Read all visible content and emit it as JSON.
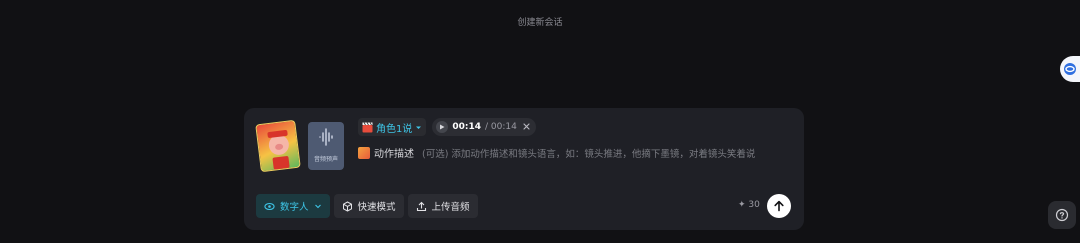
{
  "session": {
    "title": "创建新会话"
  },
  "composer": {
    "audio_thumb_label": "音频预声",
    "role": {
      "label": "角色1说"
    },
    "audio": {
      "current": "00:14",
      "total": "/ 00:14"
    },
    "action": {
      "label": "动作描述",
      "placeholder": "(可选) 添加动作描述和镜头语言，如：镜头推进，他摘下墨镜，对着镜头笑着说"
    },
    "toolbar": {
      "digital_human": "数字人",
      "fast_mode": "快速模式",
      "upload_audio": "上传音频"
    },
    "credits": "30"
  },
  "icons": [
    "help-icon",
    "ring-logo-icon",
    "play-icon",
    "close-icon",
    "eye-icon",
    "chevron-down-icon",
    "cube-icon",
    "upload-icon",
    "arrow-up-icon",
    "spark-icon",
    "waveform-icon",
    "clapper-icon"
  ],
  "colors": {
    "accent": "#3ec6e8",
    "background": "#111114",
    "panel": "#1f2026"
  }
}
